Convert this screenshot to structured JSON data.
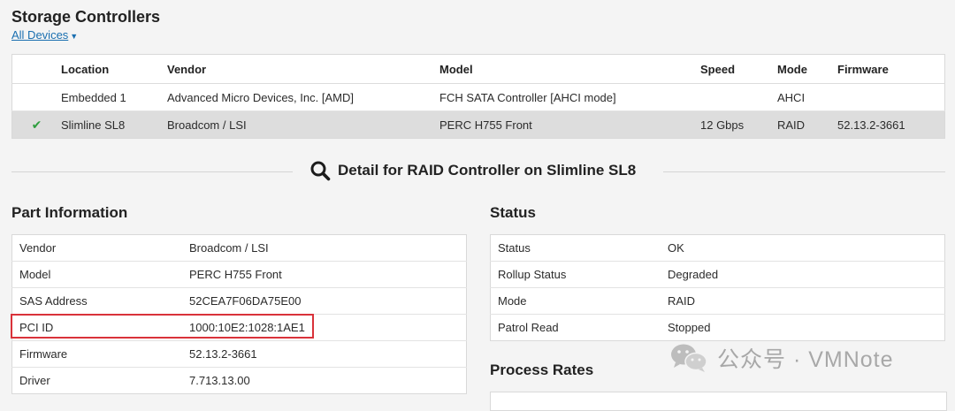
{
  "header": {
    "title": "Storage Controllers",
    "filter_label": "All Devices",
    "filter_caret": "▼"
  },
  "controllers": {
    "columns": [
      "",
      "Location",
      "Vendor",
      "Model",
      "Speed",
      "Mode",
      "Firmware"
    ],
    "rows": [
      {
        "selected": false,
        "check": "",
        "location": "Embedded 1",
        "vendor": "Advanced Micro Devices, Inc. [AMD]",
        "model": "FCH SATA Controller [AHCI mode]",
        "speed": "",
        "mode": "AHCI",
        "firmware": ""
      },
      {
        "selected": true,
        "check": "✔",
        "location": "Slimline SL8",
        "vendor": "Broadcom / LSI",
        "model": "PERC H755 Front",
        "speed": "12 Gbps",
        "mode": "RAID",
        "firmware": "52.13.2-3661"
      }
    ]
  },
  "detail": {
    "heading": "Detail for RAID Controller on Slimline SL8",
    "icon": "search-icon"
  },
  "part_info": {
    "title": "Part Information",
    "rows": [
      {
        "key": "Vendor",
        "value": "Broadcom / LSI"
      },
      {
        "key": "Model",
        "value": "PERC H755 Front"
      },
      {
        "key": "SAS Address",
        "value": "52CEA7F06DA75E00"
      },
      {
        "key": "PCI ID",
        "value": "1000:10E2:1028:1AE1"
      },
      {
        "key": "Firmware",
        "value": "52.13.2-3661"
      },
      {
        "key": "Driver",
        "value": "7.713.13.00"
      }
    ]
  },
  "status": {
    "title": "Status",
    "rows": [
      {
        "key": "Status",
        "value": "OK"
      },
      {
        "key": "Rollup Status",
        "value": "Degraded"
      },
      {
        "key": "Mode",
        "value": "RAID"
      },
      {
        "key": "Patrol Read",
        "value": "Stopped"
      }
    ]
  },
  "process_rates": {
    "title": "Process Rates"
  },
  "watermark": {
    "text": "公众号 · VMNote",
    "icon": "wechat-icon"
  },
  "colors": {
    "link": "#1a6fb0",
    "check": "#2e9e3e",
    "highlight": "#d9323a",
    "selected_row": "#dddddd"
  }
}
